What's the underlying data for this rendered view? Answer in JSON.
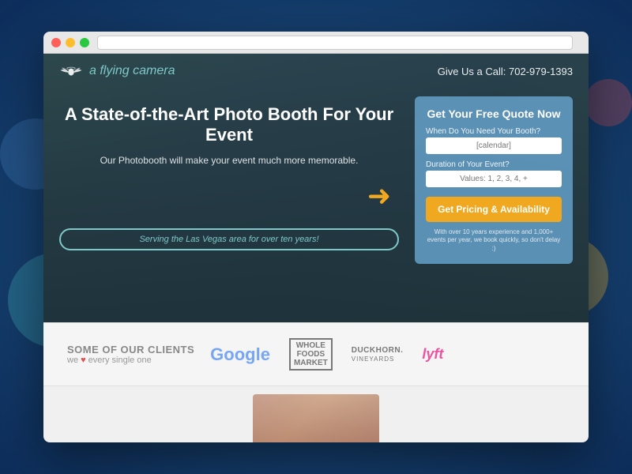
{
  "browser": {
    "url_placeholder": ""
  },
  "nav": {
    "logo_text": "a flying camera",
    "phone_label": "Give Us a Call:",
    "phone_number": "702-979-1393"
  },
  "hero": {
    "headline": "A State-of-the-Art Photo Booth For Your Event",
    "subheadline": "Our Photobooth will make your event much more memorable.",
    "serving_badge": "Serving the Las Vegas area for over ten years!"
  },
  "quote_form": {
    "title": "Get Your Free Quote Now",
    "date_label": "When Do You Need Your Booth?",
    "date_placeholder": "[calendar]",
    "duration_label": "Duration of Your Event?",
    "duration_placeholder": "Values: 1, 2, 3, 4, +",
    "cta_button": "Get Pricing & Availability",
    "disclaimer": "With over 10 years experience and 1,000+ events per year, we book quickly, so don't delay :)"
  },
  "clients": {
    "section_title": "SOME OF OUR CLIENTS",
    "section_sub_prefix": "we",
    "section_sub_suffix": "every single one",
    "logos": [
      {
        "name": "Google",
        "type": "google"
      },
      {
        "name": "Whole Foods",
        "type": "whole"
      },
      {
        "name": "Duckhorn Vineyards",
        "type": "duckhorn"
      },
      {
        "name": "Lyft",
        "type": "lyft"
      }
    ]
  },
  "colors": {
    "accent_teal": "#7ec8c8",
    "accent_orange": "#f0a820",
    "accent_red": "#e05050",
    "form_bg": "rgba(100,160,200,0.85)"
  }
}
